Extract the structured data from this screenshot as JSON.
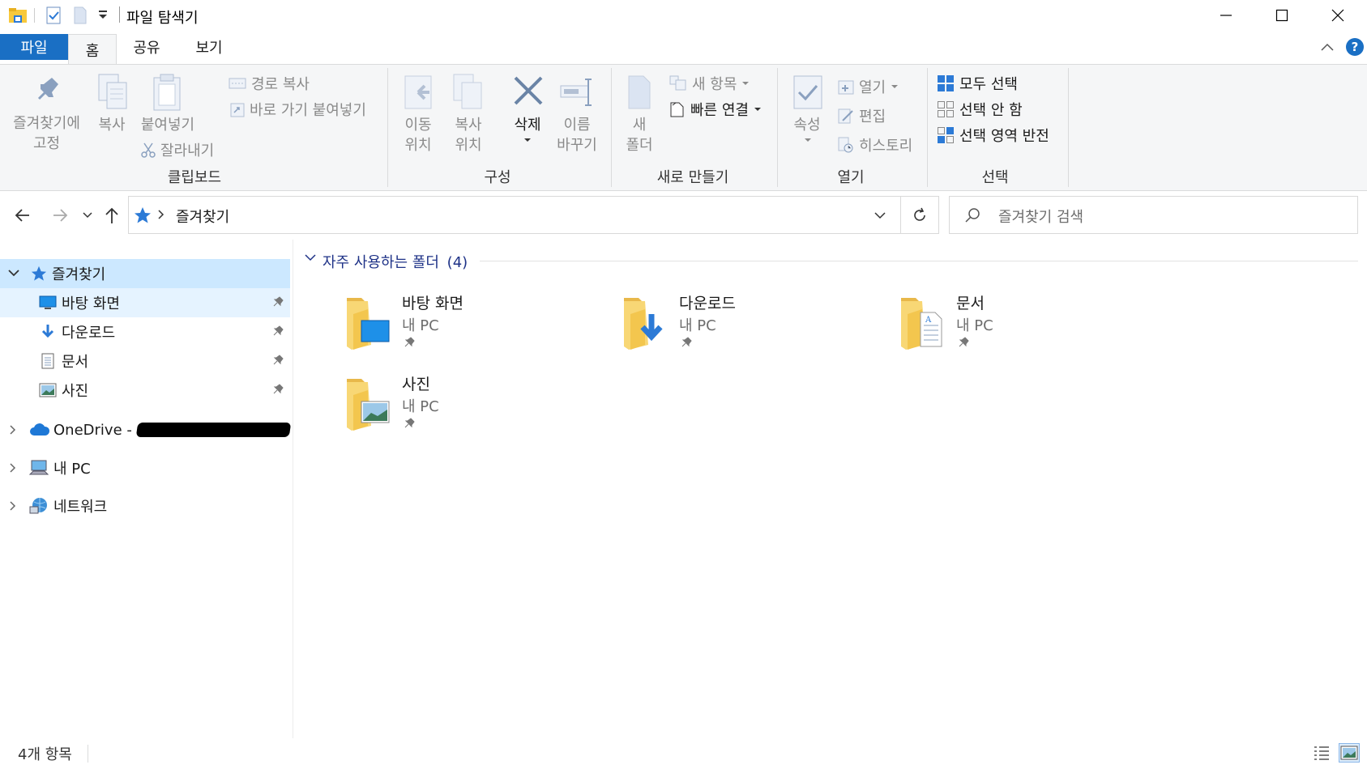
{
  "window": {
    "title": "파일 탐색기",
    "minimize_icon": "minimize-icon",
    "maximize_icon": "maximize-icon",
    "close_icon": "close-icon"
  },
  "tabs": [
    {
      "label": "파일"
    },
    {
      "label": "홈"
    },
    {
      "label": "공유"
    },
    {
      "label": "보기"
    }
  ],
  "ribbon": {
    "clipboard": {
      "title": "클립보드",
      "pin_line1": "즐겨찾기에",
      "pin_line2": "고정",
      "copy": "복사",
      "paste": "붙여넣기",
      "copy_path": "경로 복사",
      "paste_shortcut": "바로 가기 붙여넣기",
      "cut": "잘라내기"
    },
    "organize": {
      "title": "구성",
      "move_line1": "이동",
      "move_line2": "위치",
      "copy_line1": "복사",
      "copy_line2": "위치",
      "delete": "삭제",
      "rename_line1": "이름",
      "rename_line2": "바꾸기"
    },
    "new": {
      "title": "새로 만들기",
      "new_folder_line1": "새",
      "new_folder_line2": "폴더",
      "new_item": "새 항목",
      "easy_access": "빠른 연결"
    },
    "open": {
      "title": "열기",
      "properties": "속성",
      "open": "열기",
      "edit": "편집",
      "history": "히스토리"
    },
    "select": {
      "title": "선택",
      "select_all": "모두 선택",
      "select_none": "선택 안 함",
      "invert": "선택 영역 반전"
    }
  },
  "address": {
    "path": "즐겨찾기",
    "search_placeholder": "즐겨찾기 검색"
  },
  "nav": {
    "quick_access": "즐겨찾기",
    "items": [
      {
        "label": "바탕 화면"
      },
      {
        "label": "다운로드"
      },
      {
        "label": "문서"
      },
      {
        "label": "사진"
      }
    ],
    "onedrive": "OneDrive -",
    "this_pc": "내 PC",
    "network": "네트워크"
  },
  "content": {
    "section_title": "자주 사용하는 폴더",
    "section_count": "(4)",
    "folders": [
      {
        "name": "바탕 화면",
        "location": "내 PC",
        "icon": "desktop-folder-icon"
      },
      {
        "name": "다운로드",
        "location": "내 PC",
        "icon": "downloads-folder-icon"
      },
      {
        "name": "문서",
        "location": "내 PC",
        "icon": "documents-folder-icon"
      },
      {
        "name": "사진",
        "location": "내 PC",
        "icon": "pictures-folder-icon"
      }
    ]
  },
  "status": {
    "item_count": "4개 항목"
  },
  "colors": {
    "accent": "#1a6fc4",
    "selected_bg": "#cce8ff",
    "section_title": "#1e3287",
    "folder_yellow": "#f8d775"
  }
}
